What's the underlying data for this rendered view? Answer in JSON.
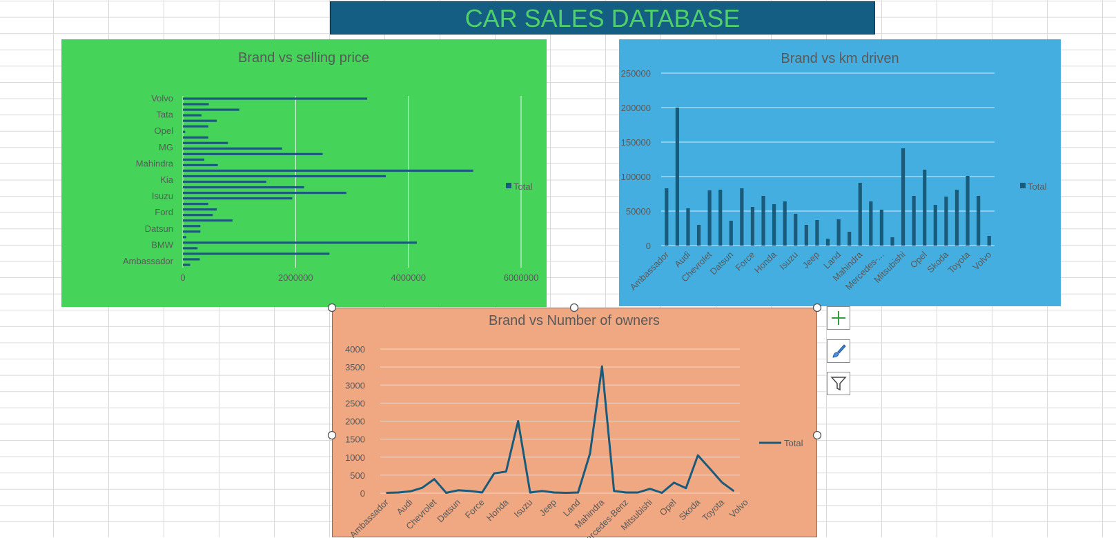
{
  "banner": {
    "title": "CAR SALES DATABASE"
  },
  "colors": {
    "banner_bg": "#135e82",
    "banner_text": "#4fd06a",
    "chart1_bg": "#45d35a",
    "chart2_bg": "#45aee0",
    "chart3_bg": "#f0a883",
    "series": "#1a5a7a",
    "axis_text": "#595959"
  },
  "chart_data": [
    {
      "type": "bar",
      "orientation": "horizontal",
      "title": "Brand vs selling price",
      "legend": [
        "Total"
      ],
      "legend_position": "right",
      "grid": true,
      "xlim": [
        0,
        6000000
      ],
      "x_ticks": [
        "0",
        "2000000",
        "4000000",
        "6000000"
      ],
      "visible_category_labels": [
        "Ambassador",
        "BMW",
        "Datsun",
        "Ford",
        "Isuzu",
        "Kia",
        "Mahindra",
        "MG",
        "Opel",
        "Tata",
        "Volvo"
      ],
      "values": [
        130000,
        300000,
        2600000,
        260000,
        4150000,
        60000,
        310000,
        310000,
        880000,
        530000,
        600000,
        450000,
        1940000,
        2900000,
        2150000,
        1480000,
        3600000,
        5150000,
        620000,
        380000,
        2480000,
        1760000,
        800000,
        450000,
        40000,
        450000,
        600000,
        330000,
        1000000,
        460000,
        3270000
      ]
    },
    {
      "type": "bar",
      "title": "Brand vs km driven",
      "legend": [
        "Total"
      ],
      "legend_position": "right",
      "grid": true,
      "ylim": [
        0,
        250000
      ],
      "y_ticks": [
        "0",
        "50000",
        "100000",
        "150000",
        "200000",
        "250000"
      ],
      "visible_category_labels": [
        "Ambassador",
        "Audi",
        "Chevrolet",
        "Datsun",
        "Force",
        "Honda",
        "Isuzu",
        "Jeep",
        "Land",
        "Mahindra",
        "Mercedes-...",
        "Mitsubishi",
        "Opel",
        "Skoda",
        "Toyota",
        "Volvo"
      ],
      "values": [
        83000,
        200000,
        54000,
        30000,
        80000,
        81000,
        36000,
        83000,
        56000,
        72000,
        60000,
        64000,
        46000,
        30000,
        37000,
        10000,
        38000,
        20000,
        91000,
        64000,
        52000,
        12000,
        141000,
        72000,
        110000,
        59000,
        71000,
        81000,
        101000,
        72000,
        14000
      ]
    },
    {
      "type": "line",
      "title": "Brand vs Number of owners",
      "legend": [
        "Total"
      ],
      "legend_position": "right",
      "grid": true,
      "ylim": [
        0,
        4000
      ],
      "y_ticks": [
        "0",
        "500",
        "1000",
        "1500",
        "2000",
        "2500",
        "3000",
        "3500",
        "4000"
      ],
      "visible_category_labels": [
        "Ambassador",
        "Audi",
        "Chevrolet",
        "Datsun",
        "Force",
        "Honda",
        "Isuzu",
        "Jeep",
        "Land",
        "Mahindra",
        "Mercedes-Benz",
        "Mitsubishi",
        "Opel",
        "Skoda",
        "Toyota",
        "Volvo"
      ],
      "values": [
        10,
        20,
        50,
        150,
        390,
        10,
        80,
        60,
        20,
        550,
        600,
        2000,
        20,
        60,
        20,
        10,
        20,
        1100,
        3520,
        60,
        20,
        20,
        120,
        10,
        290,
        140,
        1050,
        680,
        300,
        60
      ]
    }
  ]
}
